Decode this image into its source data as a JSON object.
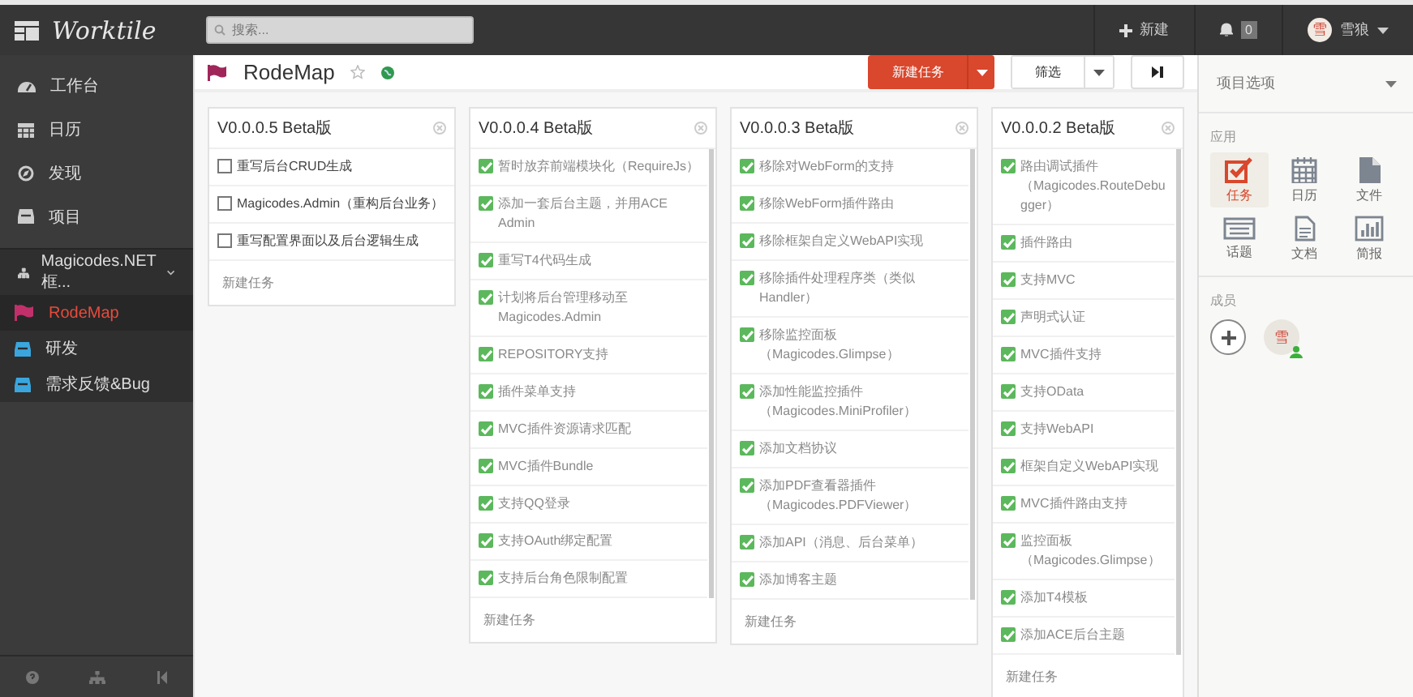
{
  "topbar": {
    "logo": "Worktile",
    "search": {
      "placeholder": "搜索..."
    },
    "new_label": "新建",
    "notifications": "0",
    "user": {
      "avatar": "雪",
      "name": "雪狼"
    }
  },
  "sidebar": {
    "items": [
      {
        "label": "工作台",
        "selected": false
      },
      {
        "label": "日历",
        "selected": false
      },
      {
        "label": "发现",
        "selected": false
      },
      {
        "label": "项目",
        "selected": false
      }
    ],
    "project": {
      "label": "Magicodes.NET框...",
      "expanded": true,
      "children": [
        {
          "label": "RodeMap",
          "kind": "flag",
          "selected": true
        },
        {
          "label": "研发",
          "kind": "box",
          "selected": false
        },
        {
          "label": "需求反馈&Bug",
          "kind": "box",
          "selected": false
        }
      ]
    }
  },
  "header": {
    "title": "RodeMap",
    "new_task_button": "新建任务",
    "filter_button": "筛选"
  },
  "columns": [
    {
      "title": "V0.0.0.5 Beta版",
      "new_task": "新建任务",
      "tasks": [
        {
          "text": "重写后台CRUD生成",
          "checked": false
        },
        {
          "text": "Magicodes.Admin（重构后台业务）",
          "checked": false
        },
        {
          "text": "重写配置界面以及后台逻辑生成",
          "checked": false
        }
      ]
    },
    {
      "title": "V0.0.0.4 Beta版",
      "new_task": "新建任务",
      "tasks": [
        {
          "text": "暂时放弃前端模块化（RequireJs）",
          "checked": true
        },
        {
          "text": "添加一套后台主题，并用ACE Admin",
          "checked": true
        },
        {
          "text": "重写T4代码生成",
          "checked": true
        },
        {
          "text": "计划将后台管理移动至Magicodes.Admin",
          "checked": true
        },
        {
          "text": "REPOSITORY支持",
          "checked": true
        },
        {
          "text": "插件菜单支持",
          "checked": true
        },
        {
          "text": "MVC插件资源请求匹配",
          "checked": true
        },
        {
          "text": "MVC插件Bundle",
          "checked": true
        },
        {
          "text": "支持QQ登录",
          "checked": true
        },
        {
          "text": "支持OAuth绑定配置",
          "checked": true
        },
        {
          "text": "支持后台角色限制配置",
          "checked": true
        }
      ]
    },
    {
      "title": "V0.0.0.3 Beta版",
      "new_task": "新建任务",
      "tasks": [
        {
          "text": "移除对WebForm的支持",
          "checked": true
        },
        {
          "text": "移除WebForm插件路由",
          "checked": true
        },
        {
          "text": "移除框架自定义WebAPI实现",
          "checked": true
        },
        {
          "text": "移除插件处理程序类（类似Handler）",
          "checked": true
        },
        {
          "text": "移除监控面板（Magicodes.Glimpse）",
          "checked": true
        },
        {
          "text": "添加性能监控插件（Magicodes.MiniProfiler）",
          "checked": true
        },
        {
          "text": "添加文档协议",
          "checked": true
        },
        {
          "text": "添加PDF查看器插件（Magicodes.PDFViewer）",
          "checked": true
        },
        {
          "text": "添加API（消息、后台菜单）",
          "checked": true
        },
        {
          "text": "添加博客主题",
          "checked": true
        }
      ]
    },
    {
      "title": "V0.0.0.2 Beta版",
      "new_task": "新建任务",
      "tasks": [
        {
          "text": "路由调试插件（Magicodes.RouteDebugger）",
          "checked": true
        },
        {
          "text": "插件路由",
          "checked": true
        },
        {
          "text": "支持MVC",
          "checked": true
        },
        {
          "text": "声明式认证",
          "checked": true
        },
        {
          "text": "MVC插件支持",
          "checked": true
        },
        {
          "text": "支持OData",
          "checked": true
        },
        {
          "text": "支持WebAPI",
          "checked": true
        },
        {
          "text": "框架自定义WebAPI实现",
          "checked": true
        },
        {
          "text": "MVC插件路由支持",
          "checked": true
        },
        {
          "text": "监控面板（Magicodes.Glimpse）",
          "checked": true
        },
        {
          "text": "添加T4模板",
          "checked": true
        },
        {
          "text": "添加ACE后台主题",
          "checked": true
        }
      ]
    }
  ],
  "panel": {
    "title": "项目选项",
    "apps_label": "应用",
    "apps": [
      {
        "label": "任务",
        "selected": true
      },
      {
        "label": "日历",
        "selected": false
      },
      {
        "label": "文件",
        "selected": false
      },
      {
        "label": "话题",
        "selected": false
      },
      {
        "label": "文档",
        "selected": false
      },
      {
        "label": "简报",
        "selected": false
      }
    ],
    "members_label": "成员",
    "members": [
      {
        "avatar": "雪",
        "online": true
      }
    ]
  }
}
